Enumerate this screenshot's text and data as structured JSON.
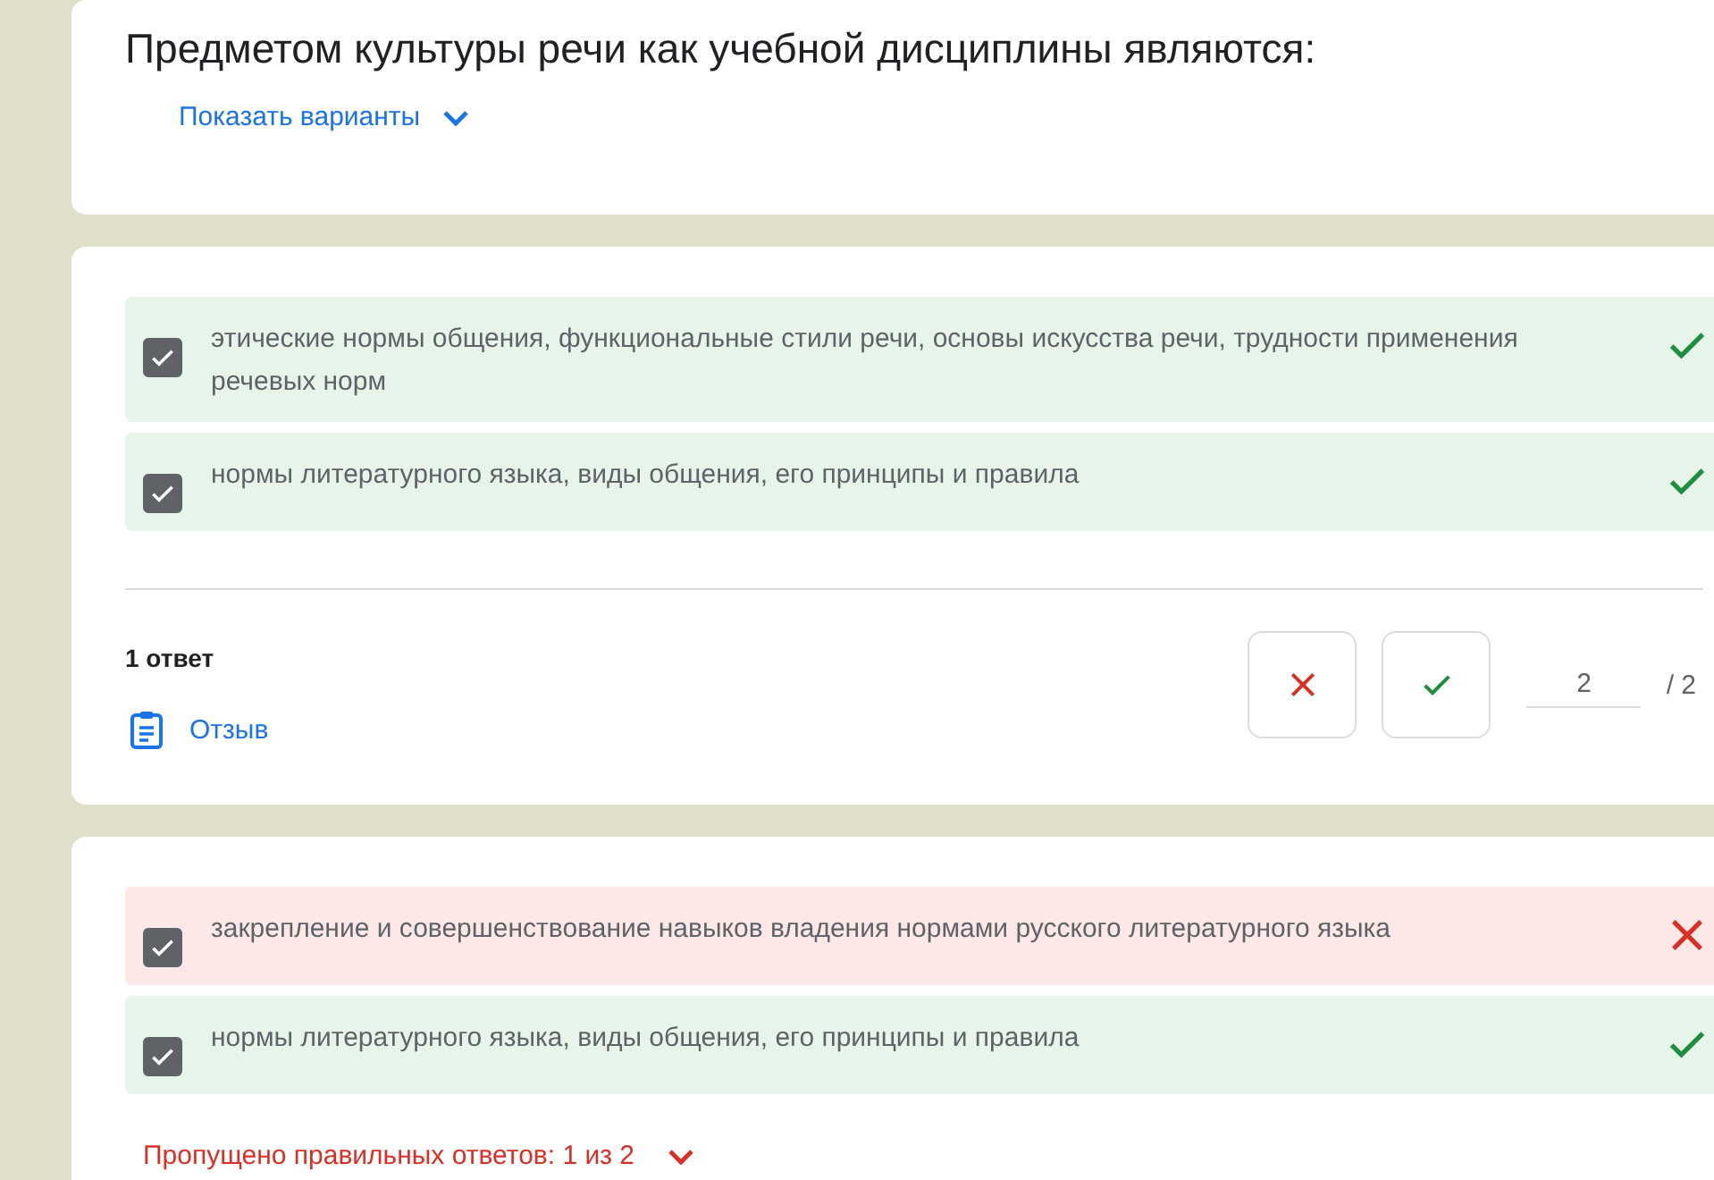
{
  "question": {
    "title": "Предметом культуры речи как учебной дисциплины являются:",
    "show_options": "Показать варианты"
  },
  "responses": [
    {
      "options": [
        {
          "text": "этические нормы общения, функциональные стили речи, основы искусства речи, трудности применения речевых норм",
          "checked": true,
          "correct": true
        },
        {
          "text": "нормы литературного языка, виды общения, его принципы и правила",
          "checked": true,
          "correct": true
        }
      ],
      "summary": {
        "count": "1 ответ",
        "feedback": "Отзыв",
        "score": "2",
        "max_score": "/ 2"
      }
    },
    {
      "options": [
        {
          "text": "закрепление и совершенствование навыков владения нормами русского литературного языка",
          "checked": true,
          "correct": false
        },
        {
          "text": "нормы литературного языка, виды общения, его принципы и правила",
          "checked": true,
          "correct": true
        }
      ],
      "missed": "Пропущено правильных ответов: 1 из 2"
    }
  ]
}
